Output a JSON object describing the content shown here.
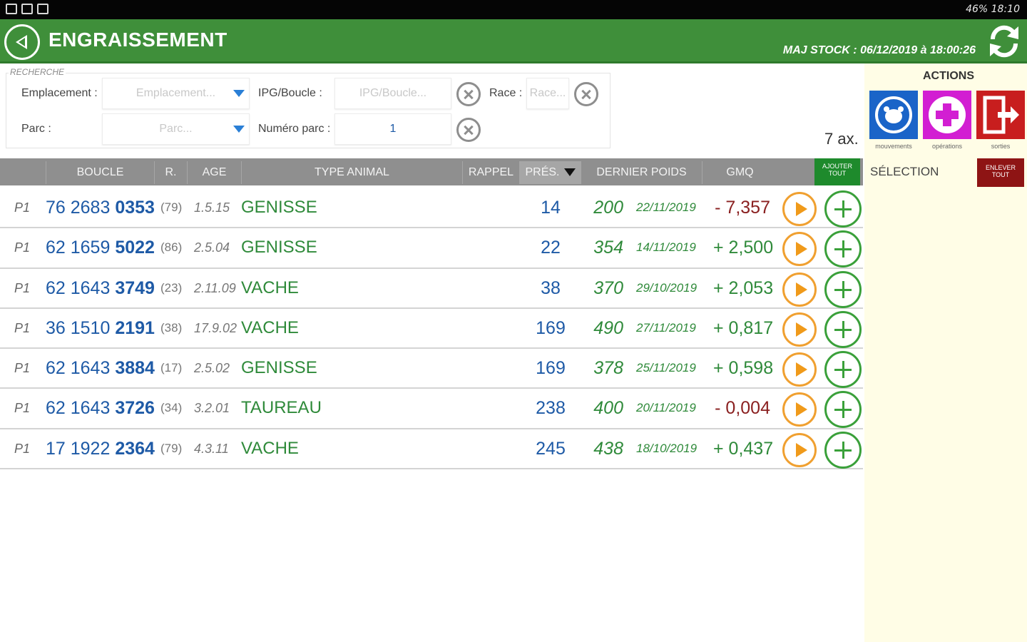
{
  "status_bar": {
    "right": "46% 18:10"
  },
  "app_bar": {
    "title": "ENGRAISSEMENT",
    "maj_stock": "MAJ STOCK : 06/12/2019 à 18:00:26"
  },
  "search": {
    "legend": "RECHERCHE",
    "emplacement_label": "Emplacement :",
    "emplacement_placeholder": "Emplacement...",
    "ipg_label": "IPG/Boucle :",
    "ipg_placeholder": "IPG/Boucle...",
    "race_label": "Race :",
    "race_placeholder": "Race...",
    "parc_label": "Parc :",
    "parc_placeholder": "Parc...",
    "numero_parc_label": "Numéro parc :",
    "numero_parc_value": "1"
  },
  "count_label": "7 ax.",
  "actions": {
    "title": "ACTIONS",
    "buttons": [
      {
        "caption": "mouvements",
        "color": "#1a64c8"
      },
      {
        "caption": "opérations",
        "color": "#d21ed2"
      },
      {
        "caption": "sorties",
        "color": "#c81e1e"
      }
    ],
    "selection_label": "SÉLECTION",
    "remove_all": "ENLEVER TOUT"
  },
  "table": {
    "headers": {
      "boucle": "BOUCLE",
      "r": "R.",
      "age": "AGE",
      "type": "TYPE ANIMAL",
      "rappel": "RAPPEL",
      "pres": "PRÉS.",
      "poids": "DERNIER POIDS",
      "gmq": "GMQ",
      "add_all": "AJOUTER TOUT"
    },
    "rows": [
      {
        "p": "P1",
        "boucle_a": "76 2683 ",
        "boucle_b": "0353",
        "r": "(79)",
        "age": "1.5.15",
        "type": "GENISSE",
        "pres": "14",
        "poids": "200",
        "date": "22/11/2019",
        "gmq": "- 7,357",
        "gmq_sign": "neg"
      },
      {
        "p": "P1",
        "boucle_a": "62 1659 ",
        "boucle_b": "5022",
        "r": "(86)",
        "age": "2.5.04",
        "type": "GENISSE",
        "pres": "22",
        "poids": "354",
        "date": "14/11/2019",
        "gmq": "+ 2,500",
        "gmq_sign": "pos"
      },
      {
        "p": "P1",
        "boucle_a": "62 1643 ",
        "boucle_b": "3749",
        "r": "(23)",
        "age": "2.11.09",
        "type": "VACHE",
        "pres": "38",
        "poids": "370",
        "date": "29/10/2019",
        "gmq": "+ 2,053",
        "gmq_sign": "pos"
      },
      {
        "p": "P1",
        "boucle_a": "36 1510 ",
        "boucle_b": "2191",
        "r": "(38)",
        "age": "17.9.02",
        "type": "VACHE",
        "pres": "169",
        "poids": "490",
        "date": "27/11/2019",
        "gmq": "+ 0,817",
        "gmq_sign": "pos"
      },
      {
        "p": "P1",
        "boucle_a": "62 1643 ",
        "boucle_b": "3884",
        "r": "(17)",
        "age": "2.5.02",
        "type": "GENISSE",
        "pres": "169",
        "poids": "378",
        "date": "25/11/2019",
        "gmq": "+ 0,598",
        "gmq_sign": "pos"
      },
      {
        "p": "P1",
        "boucle_a": "62 1643 ",
        "boucle_b": "3726",
        "r": "(34)",
        "age": "3.2.01",
        "type": "TAUREAU",
        "pres": "238",
        "poids": "400",
        "date": "20/11/2019",
        "gmq": "- 0,004",
        "gmq_sign": "neg"
      },
      {
        "p": "P1",
        "boucle_a": "17 1922 ",
        "boucle_b": "2364",
        "r": "(79)",
        "age": "4.3.11",
        "type": "VACHE",
        "pres": "245",
        "poids": "438",
        "date": "18/10/2019",
        "gmq": "+ 0,437",
        "gmq_sign": "pos"
      }
    ]
  }
}
